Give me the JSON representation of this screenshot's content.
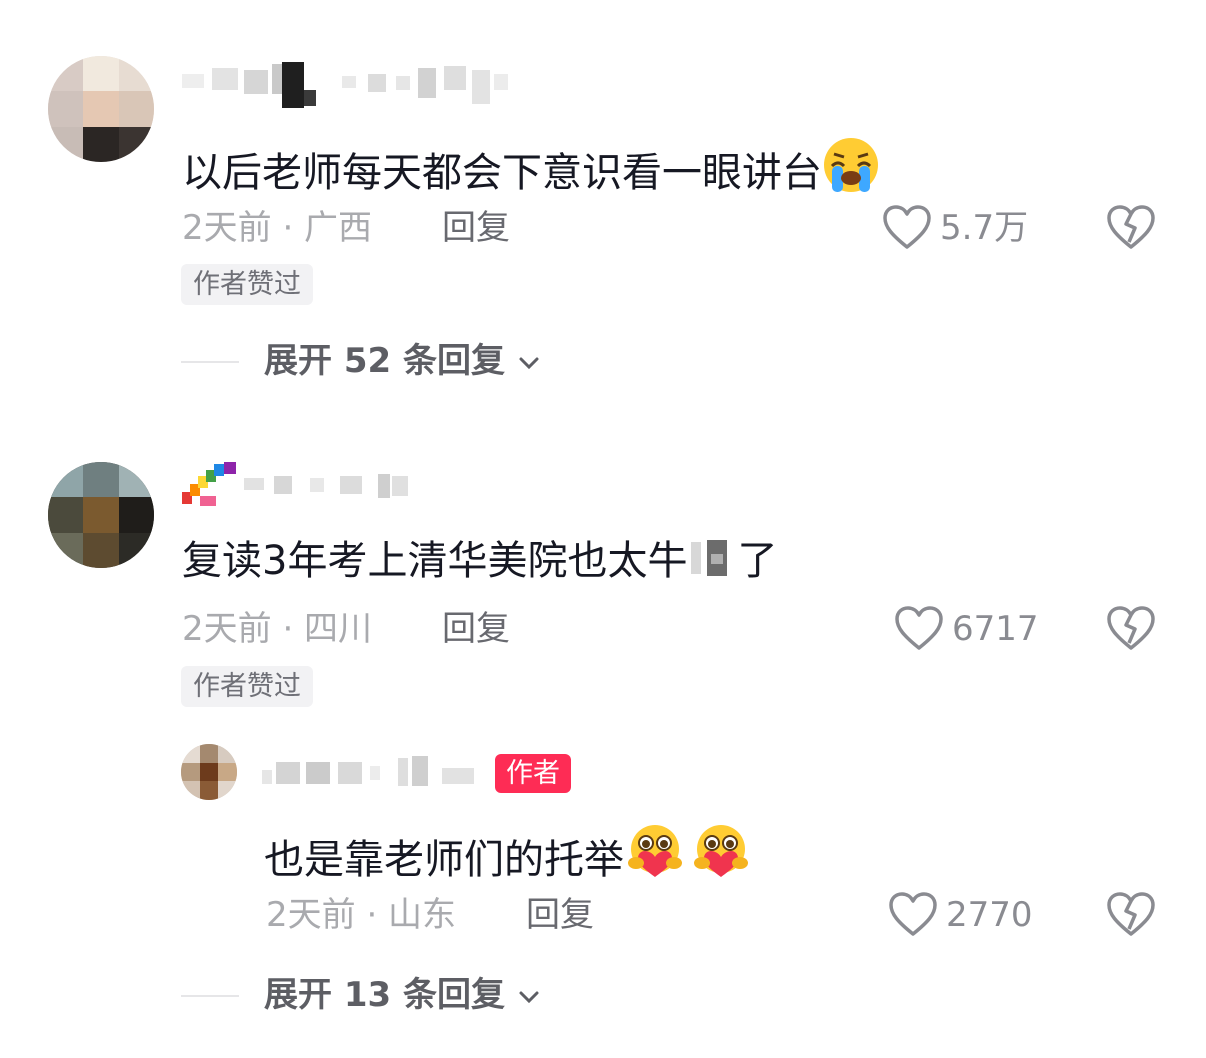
{
  "comments": [
    {
      "text": "以后老师每天都会下意识看一眼讲台",
      "emoji_name": "loudly-crying-face",
      "time_location": "2天前 · 广西",
      "reply_label": "回复",
      "like_count": "5.7万",
      "badge": "作者赞过",
      "expand": "展开 52 条回复"
    },
    {
      "text": "复读3年考上清华美院也太牛",
      "text_after": "了",
      "time_location": "2天前 · 四川",
      "reply_label": "回复",
      "like_count": "6717",
      "badge": "作者赞过",
      "reply": {
        "author_tag": "作者",
        "text": "也是靠老师们的托举",
        "emoji_name": "hugging-heart-face",
        "time_location": "2天前 · 山东",
        "reply_label": "回复",
        "like_count": "2770"
      },
      "expand": "展开 13 条回复"
    }
  ],
  "colors": {
    "accent": "#fe2c55",
    "text": "#161823",
    "meta": "#a9aaae"
  }
}
